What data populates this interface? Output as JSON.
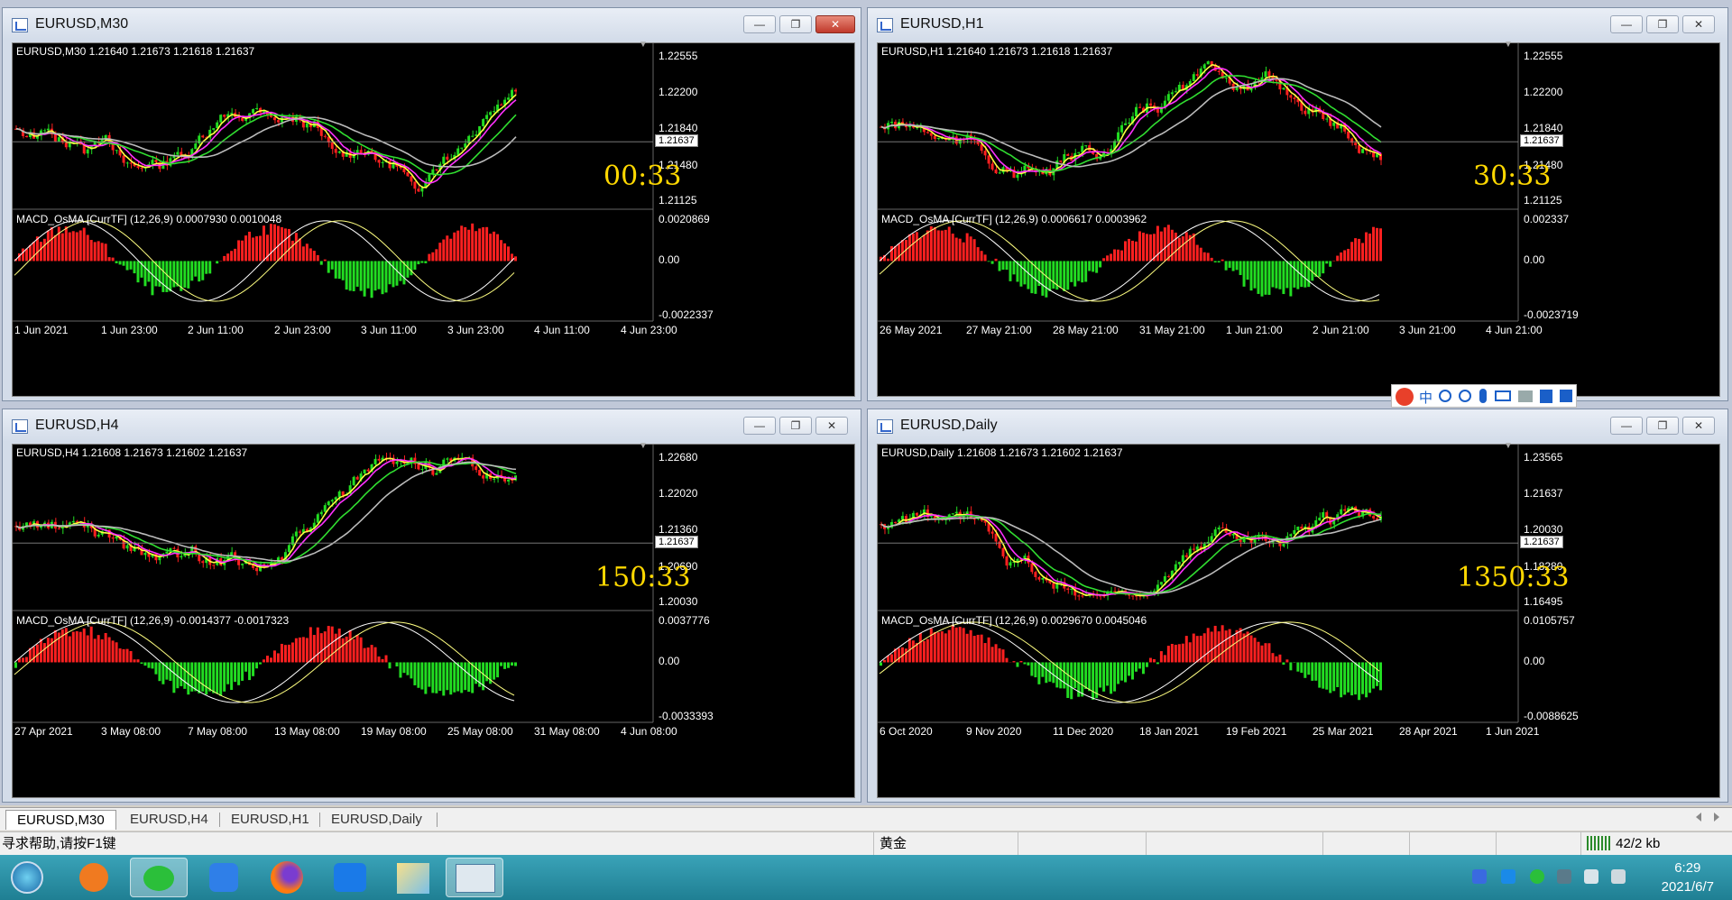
{
  "windows": [
    {
      "id": "m30",
      "title": "EURUSD,M30",
      "header": "EURUSD,M30  1.21640 1.21673 1.21618 1.21637",
      "timer": "00:33",
      "prices": [
        "1.22555",
        "1.22200",
        "1.21840",
        "1.21480",
        "1.21125"
      ],
      "current_price": "1.21637",
      "macd_header": "MACD_OsMA [CurrTF] (12,26,9) 0.0007930 0.0010048",
      "macd_scale": [
        "0.0020869",
        "0.00",
        "-0.0022337"
      ],
      "dates": [
        "1 Jun 2021",
        "1 Jun 23:00",
        "2 Jun 11:00",
        "2 Jun 23:00",
        "3 Jun 11:00",
        "3 Jun 23:00",
        "4 Jun 11:00",
        "4 Jun 23:00"
      ],
      "close_active": true
    },
    {
      "id": "h1",
      "title": "EURUSD,H1",
      "header": "EURUSD,H1  1.21640 1.21673 1.21618 1.21637",
      "timer": "30:33",
      "prices": [
        "1.22555",
        "1.22200",
        "1.21840",
        "1.21480",
        "1.21125"
      ],
      "current_price": "1.21637",
      "macd_header": "MACD_OsMA [CurrTF] (12,26,9) 0.0006617 0.0003962",
      "macd_scale": [
        "0.002337",
        "0.00",
        "-0.0023719"
      ],
      "dates": [
        "26 May 2021",
        "27 May 21:00",
        "28 May 21:00",
        "31 May 21:00",
        "1 Jun 21:00",
        "2 Jun 21:00",
        "3 Jun 21:00",
        "4 Jun 21:00"
      ],
      "close_active": false
    },
    {
      "id": "h4",
      "title": "EURUSD,H4",
      "header": "EURUSD,H4  1.21608 1.21673 1.21602 1.21637",
      "timer": "150:33",
      "prices": [
        "1.22680",
        "1.22020",
        "1.21360",
        "1.20690",
        "1.20030"
      ],
      "current_price": "1.21637",
      "macd_header": "MACD_OsMA [CurrTF] (12,26,9) -0.0014377 -0.0017323",
      "macd_scale": [
        "0.0037776",
        "0.00",
        "-0.0033393"
      ],
      "dates": [
        "27 Apr 2021",
        "3 May 08:00",
        "7 May 08:00",
        "13 May 08:00",
        "19 May 08:00",
        "25 May 08:00",
        "31 May 08:00",
        "4 Jun 08:00"
      ],
      "close_active": false
    },
    {
      "id": "d1",
      "title": "EURUSD,Daily",
      "header": "EURUSD,Daily  1.21608 1.21673 1.21602 1.21637",
      "timer": "1350:33",
      "prices": [
        "1.23565",
        "1.21637",
        "1.20030",
        "1.18280",
        "1.16495"
      ],
      "current_price": "1.21637",
      "macd_header": "MACD_OsMA [CurrTF] (12,26,9) 0.0029670 0.0045046",
      "macd_scale": [
        "0.0105757",
        "0.00",
        "-0.0088625"
      ],
      "dates": [
        "6 Oct 2020",
        "9 Nov 2020",
        "11 Dec 2020",
        "18 Jan 2021",
        "19 Feb 2021",
        "25 Mar 2021",
        "28 Apr 2021",
        "1 Jun 2021"
      ],
      "close_active": false
    }
  ],
  "window_controls": {
    "minimize": "—",
    "restore": "❐",
    "close": "✕"
  },
  "tabs": [
    "EURUSD,M30",
    "EURUSD,H4",
    "EURUSD,H1",
    "EURUSD,Daily"
  ],
  "active_tab": 0,
  "status": {
    "help": "寻求帮助,请按F1键",
    "profile": "黄金",
    "traffic": "42/2 kb"
  },
  "ime_bar": {
    "label": "中"
  },
  "clock": {
    "time": "6:29",
    "date": "2021/6/7"
  },
  "colors": {
    "bull": "#ff2020",
    "bear": "#22dd22",
    "ma_fast": "#ffff40",
    "ma_mid": "#ff30ff",
    "ma_slow": "#30dd30",
    "ma_long": "#bbbbbb",
    "timer": "#ffd800"
  }
}
